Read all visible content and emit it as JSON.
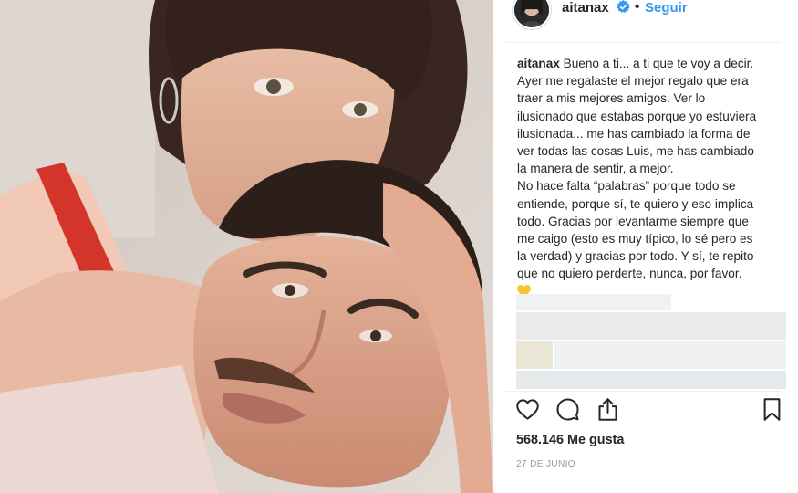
{
  "post": {
    "username": "aitanax",
    "follow_label": "Seguir",
    "separator": "•",
    "caption_user": "aitanax",
    "caption_text": " Bueno a ti... a ti que te voy a decir.\nAyer me regalaste el mejor regalo que era\ntraer a mis mejores amigos. Ver lo\nilusionado que estabas porque yo estuviera\nilusionada... me has cambiado la forma de\nver todas las cosas Luis, me has cambiado\nla manera de sentir, a mejor.\nNo hace falta “palabras” porque todo se\nentiende, porque sí, te quiero y eso implica\ntodo. Gracias por levantarme siempre que\nme caigo (esto es muy típico, lo sé pero es\nla verdad) y gracias por todo. Y sí, te repito\nque no quiero perderte, nunca, por favor.",
    "likes": "568.146 Me gusta",
    "date": "27 DE JUNIO"
  },
  "icons": {
    "verified": "verified-badge-icon",
    "heart_emoji": "yellow-heart-icon",
    "like": "heart-outline-icon",
    "comment": "comment-bubble-icon",
    "share": "share-upload-icon",
    "save": "bookmark-icon"
  },
  "colors": {
    "accent": "#3897f0",
    "text": "#262626",
    "muted": "#999999",
    "divider": "#efefef",
    "blur": "#e9ecef",
    "emoji_yellow": "#f7c531"
  }
}
